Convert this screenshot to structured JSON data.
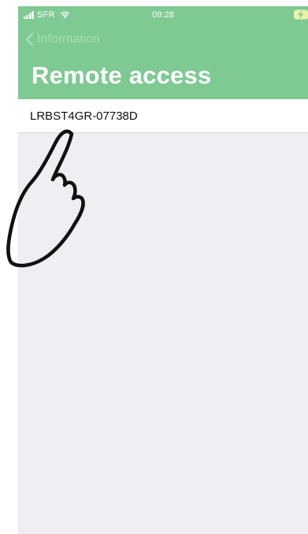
{
  "status_bar": {
    "carrier": "SFR",
    "time": "09:28"
  },
  "nav": {
    "back_label": "Information",
    "title": "Remote access"
  },
  "devices": [
    {
      "name": "LRBST4GR-07738D"
    }
  ],
  "colors": {
    "header": "#7fc993",
    "background": "#eeeef3",
    "back_text": "#a6dfb5"
  },
  "icons": {
    "signal": "signal-icon",
    "wifi": "wifi-icon",
    "battery": "battery-charging-icon",
    "back": "chevron-left-icon"
  }
}
